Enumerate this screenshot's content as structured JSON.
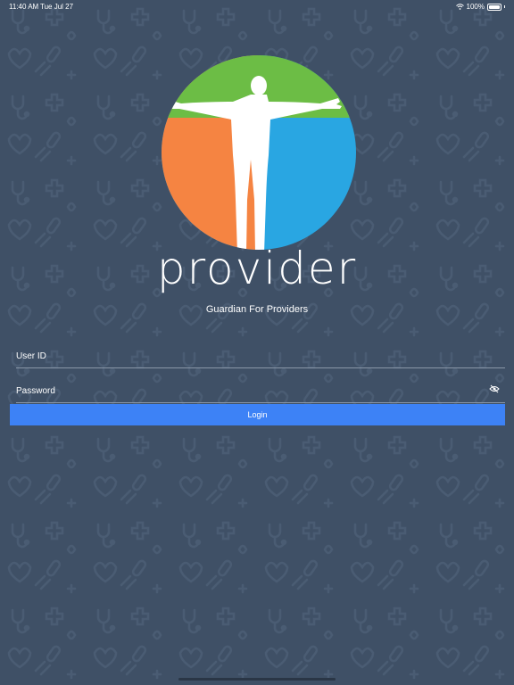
{
  "status_bar": {
    "time": "11:40 AM",
    "date": "Tue Jul 27",
    "battery": "100%"
  },
  "brand": {
    "name": "provider",
    "tagline": "Guardian For Providers"
  },
  "form": {
    "user_id_placeholder": "User ID",
    "password_placeholder": "Password",
    "login_label": "Login"
  },
  "colors": {
    "background": "#3f5066",
    "logo_green": "#6cbd45",
    "logo_orange": "#f58442",
    "logo_blue": "#29a6e2",
    "button": "#3d82f6"
  },
  "icons": {
    "wifi": "wifi-icon",
    "battery": "battery-icon",
    "eye": "eye-slash-icon"
  }
}
